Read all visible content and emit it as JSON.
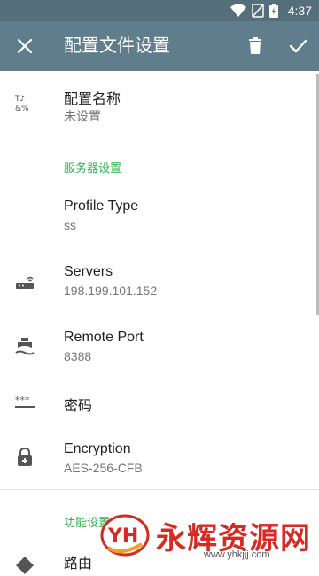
{
  "status": {
    "time": "4:37"
  },
  "toolbar": {
    "title": "配置文件设置"
  },
  "profile": {
    "title": "配置名称",
    "value": "未设置"
  },
  "server_section": {
    "title": "服务器设置"
  },
  "items": [
    {
      "title": "Profile Type",
      "value": "ss"
    },
    {
      "title": "Servers",
      "value": "198.199.101.152"
    },
    {
      "title": "Remote Port",
      "value": "8388"
    },
    {
      "title": "密码",
      "value": ""
    },
    {
      "title": "Encryption",
      "value": "AES-256-CFB"
    }
  ],
  "feature_section": {
    "title": "功能设置"
  },
  "routing": {
    "title": "路由"
  },
  "watermark": {
    "logo_text": "YH",
    "text": "永辉资源网",
    "url": "www.yhkjjj.com"
  },
  "colors": {
    "toolbar": "#607d8b",
    "statusbar": "#546e7a",
    "accent": "#2bb24c"
  }
}
